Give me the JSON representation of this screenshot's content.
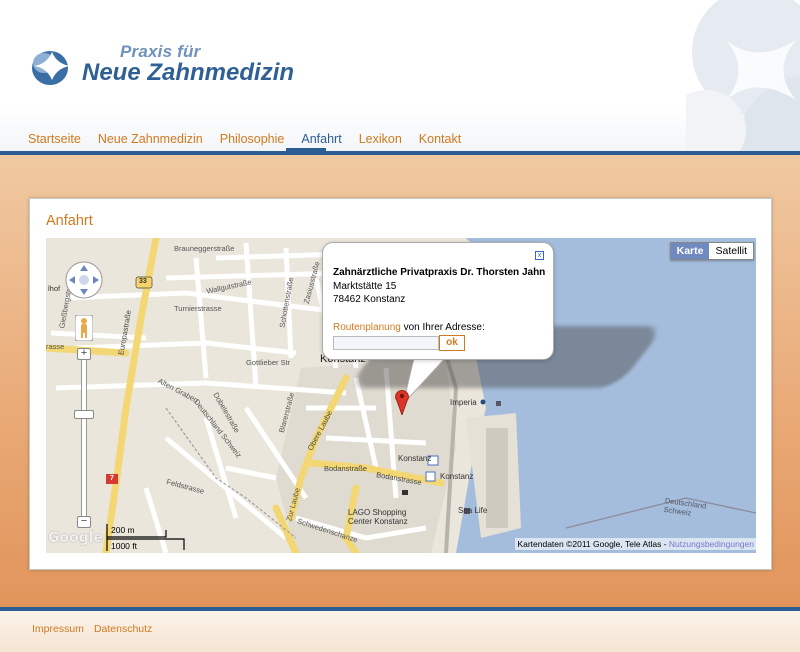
{
  "logo": {
    "line1": "Praxis für",
    "line2": "Neue Zahnmedizin"
  },
  "nav": [
    {
      "label": "Startseite",
      "active": false
    },
    {
      "label": "Neue Zahnmedizin",
      "active": false
    },
    {
      "label": "Philosophie",
      "active": false
    },
    {
      "label": "Anfahrt",
      "active": true
    },
    {
      "label": "Lexikon",
      "active": false
    },
    {
      "label": "Kontakt",
      "active": false
    }
  ],
  "page": {
    "title": "Anfahrt"
  },
  "map": {
    "type_buttons": {
      "map": "Karte",
      "satellite": "Satellit"
    },
    "info": {
      "name": "Zahnärztliche Privatpraxis Dr. Thorsten Jahn",
      "street": "Marktstätte 15",
      "city": "78462 Konstanz",
      "route_link": "Routenplanung",
      "route_text": " von Ihrer Adresse:",
      "ok": "ok",
      "close": "x"
    },
    "scale": {
      "metric": "200 m",
      "imperial": "1000 ft"
    },
    "logo": "Google",
    "attribution": {
      "text": "Kartendaten ©2011 Google, Tele Atlas - ",
      "link": "Nutzungsbedingungen"
    },
    "labels": {
      "city": "Konstanz",
      "road_33": "33",
      "road_7": "7",
      "europastrasse": "Europastraße",
      "bodanstrasse1": "Bodanstraße",
      "bodanstrasse2": "Bodanstrasse",
      "obere_laube": "Obere Laube",
      "zur_laube": "Zur Laube",
      "schwedenschanze": "Schwedenschanze",
      "feldstrasse": "Feldstrasse",
      "turnierstrasse": "Turnierstrasse",
      "walgutstrasse": "Wallgutstraße",
      "gottlieber": "Gottlieber Str",
      "giesberg": "Gießbergstraße",
      "alten_graben": "Alten Graben",
      "dobelestrasse": "Dobelestraße",
      "blarerstrasse": "Blarerstraße",
      "konstanz_station": "Konstanz",
      "imperia": "Imperia",
      "sea_life": "Sea Life",
      "lago": "LAGO Shopping Center Konstanz",
      "border_de_ch": "Deutschland Schweiz",
      "border_de_ch_2": "Deutschland Schweiz",
      "hof": "lhof",
      "strasse": "rasse",
      "zasius": "Zasiusstraße",
      "brauneggstr": "Brauneggerstraße",
      "schottenstr": "Schottenstraße"
    }
  },
  "footer": [
    {
      "label": "Impressum"
    },
    {
      "label": "Datenschutz"
    }
  ],
  "colors": {
    "accent": "#d07a1f",
    "brand": "#2c5d94"
  }
}
